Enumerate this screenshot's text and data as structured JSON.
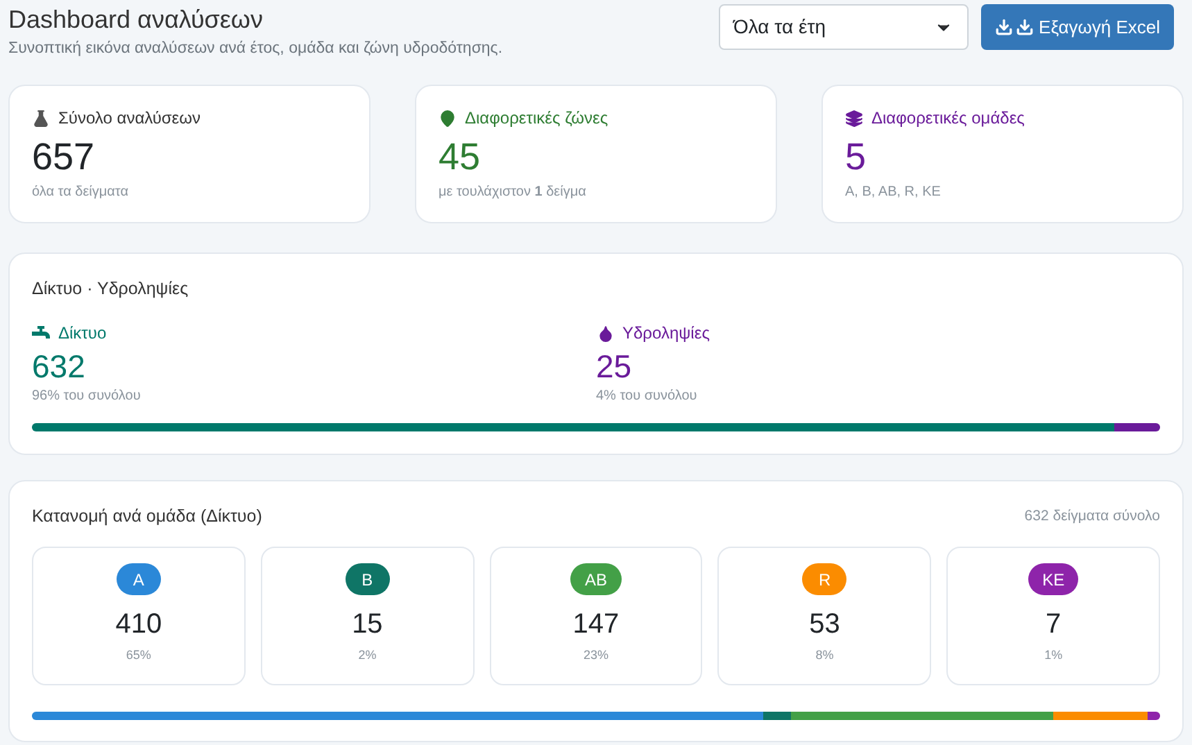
{
  "header": {
    "title": "Dashboard αναλύσεων",
    "subtitle": "Συνοπτική εικόνα αναλύσεων ανά έτος, ομάδα και ζώνη υδροδότησης.",
    "year_select": {
      "value": "Όλα τα έτη"
    },
    "export_button": {
      "label": "Εξαγωγή Excel"
    }
  },
  "stats": [
    {
      "kind": "flask",
      "label": "Σύνολο αναλύσεων",
      "value": "657",
      "note": "όλα τα δείγματα",
      "color": "#212529"
    },
    {
      "kind": "pin",
      "label": "Διαφορετικές ζώνες",
      "value": "45",
      "note": "με τουλάχιστον **1** δείγμα",
      "color": "#2e7d32"
    },
    {
      "kind": "layers",
      "label": "Διαφορετικές ομάδες",
      "value": "5",
      "note": "A, B, AB, R, KE",
      "color": "#6a1b9a"
    }
  ],
  "sources": {
    "title": "Δίκτυο · Υδροληψίες",
    "items": [
      {
        "kind": "faucet",
        "label": "Δίκτυο",
        "value": "632",
        "note": "96% του συνόλου",
        "color": "#00796b",
        "level": 0.96
      },
      {
        "kind": "drop",
        "label": "Υδροληψίες",
        "value": "25",
        "note": "4% του συνόλου",
        "color": "#6a1b9a",
        "level": 0.04
      }
    ]
  },
  "groups": {
    "title": "Κατανομή ανά ομάδα (Δίκτυο)",
    "total": "632 δείγματα σύνολο",
    "items": [
      {
        "badge": "A",
        "value": "410",
        "percent": "65%",
        "color": "#2b88d8"
      },
      {
        "badge": "B",
        "value": "15",
        "percent": "2%",
        "color": "#0f7566"
      },
      {
        "badge": "AB",
        "value": "147",
        "percent": "23%",
        "color": "#43a047"
      },
      {
        "badge": "R",
        "value": "53",
        "percent": "8%",
        "color": "#fb8c00"
      },
      {
        "badge": "KE",
        "value": "7",
        "percent": "1%",
        "color": "#8e24aa"
      }
    ]
  }
}
